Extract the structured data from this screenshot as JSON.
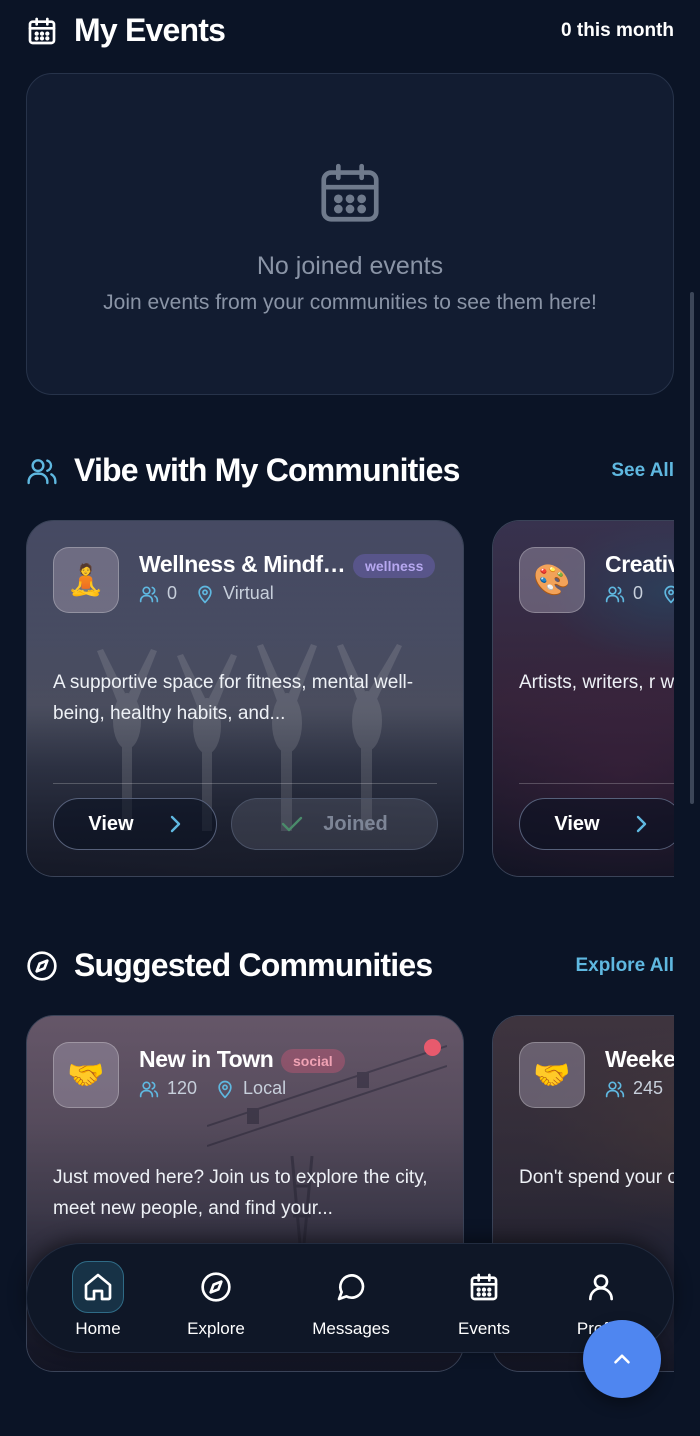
{
  "my_events": {
    "title": "My Events",
    "count_label": "0 this month",
    "empty_title": "No joined events",
    "empty_subtitle": "Join events from your communities to see them here!"
  },
  "my_communities": {
    "title": "Vibe with My Communities",
    "link": "See All",
    "cards": [
      {
        "name": "Wellness & Mindf…",
        "tag": "wellness",
        "members": "0",
        "location": "Virtual",
        "description": "A supportive space for fitness, mental well-being, healthy habits, and...",
        "view_label": "View",
        "joined_label": "Joined",
        "icon": "meditation-emoji"
      },
      {
        "name": "Creativ",
        "members": "0",
        "description": "Artists, writers, r who share, collal",
        "view_label": "View",
        "icon": "palette-emoji"
      }
    ]
  },
  "suggested": {
    "title": "Suggested Communities",
    "link": "Explore All",
    "cards": [
      {
        "name": "New in Town",
        "tag": "social",
        "members": "120",
        "location": "Local",
        "description": "Just moved here? Join us to explore the city, meet new people, and find your...",
        "icon": "handshake-emoji"
      },
      {
        "name": "Weeke",
        "members": "245",
        "description": "Don't spend your organize group a",
        "icon": "handshake-emoji"
      }
    ]
  },
  "nav": {
    "items": [
      {
        "label": "Home",
        "icon": "home-icon",
        "active": true
      },
      {
        "label": "Explore",
        "icon": "compass-icon"
      },
      {
        "label": "Messages",
        "icon": "chat-icon"
      },
      {
        "label": "Events",
        "icon": "calendar-icon"
      },
      {
        "label": "Profile",
        "icon": "user-icon"
      }
    ]
  },
  "colors": {
    "background": "#0b1426",
    "accent_link": "#5fb8e0",
    "fab": "#4f86f0",
    "wellness_tag": "#7a6bd8",
    "social_tag": "#e05a7a"
  }
}
